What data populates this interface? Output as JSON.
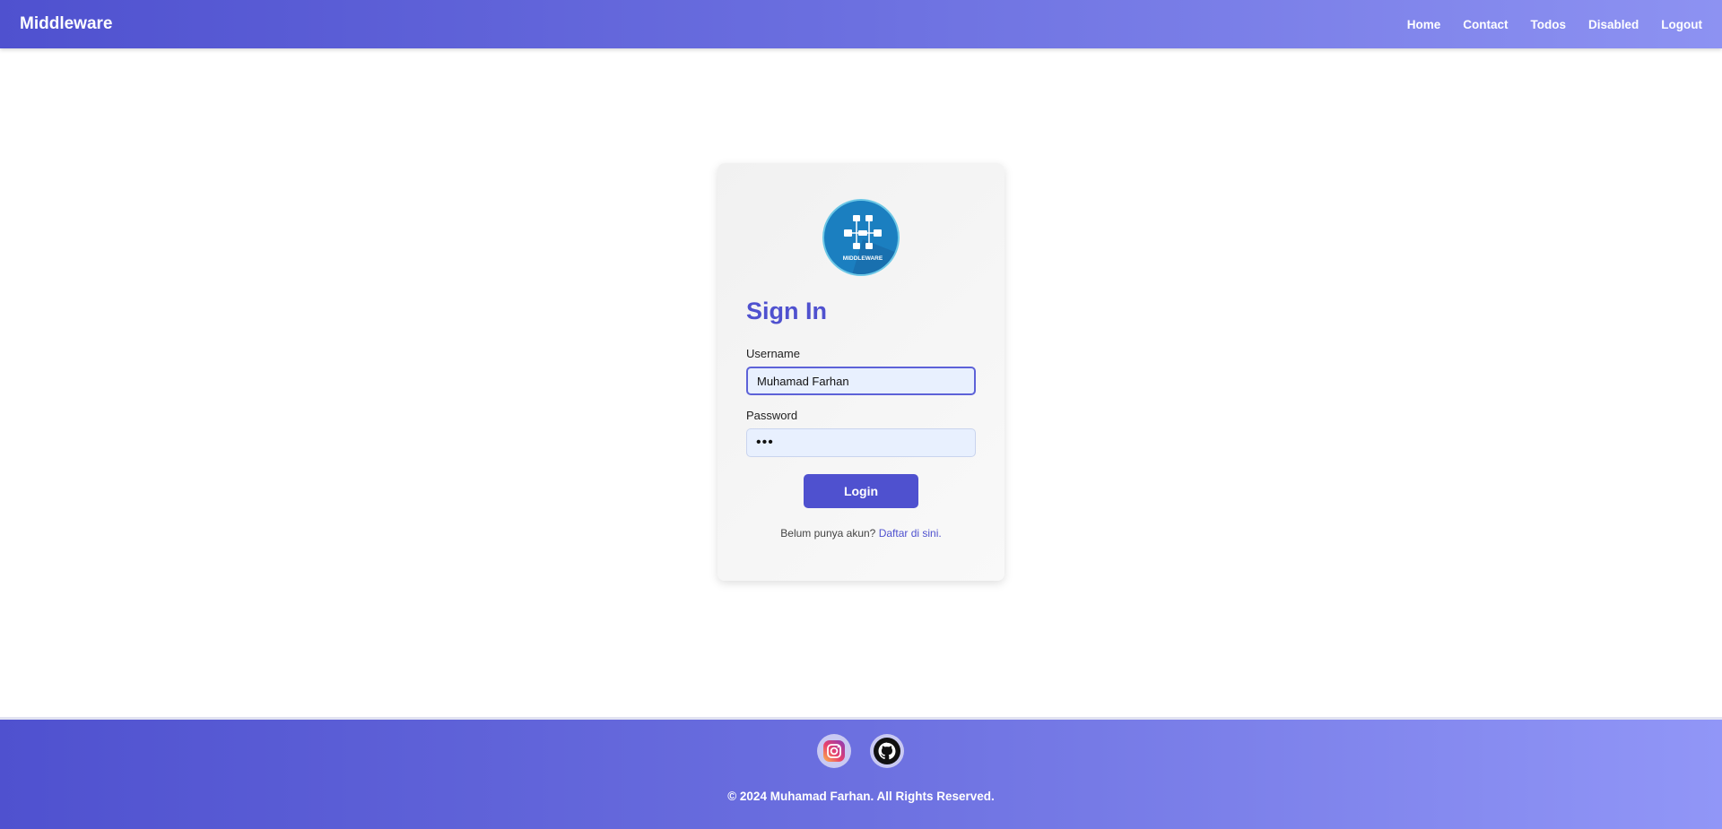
{
  "navbar": {
    "brand": "Middleware",
    "links": [
      "Home",
      "Contact",
      "Todos",
      "Disabled",
      "Logout"
    ]
  },
  "login_card": {
    "logo_text": "MIDDLEWARE",
    "title": "Sign In",
    "username_label": "Username",
    "username_value": "Muhamad Farhan",
    "password_label": "Password",
    "password_value": "•••",
    "login_button": "Login",
    "register_prompt": "Belum punya akun?",
    "register_link": "Daftar di sini."
  },
  "footer": {
    "icons": [
      "instagram-icon",
      "github-icon"
    ],
    "copyright": "© 2024 Muhamad Farhan. All Rights Reserved."
  },
  "colors": {
    "accent": "#4f51cf",
    "input_bg": "#e8f0fe"
  }
}
